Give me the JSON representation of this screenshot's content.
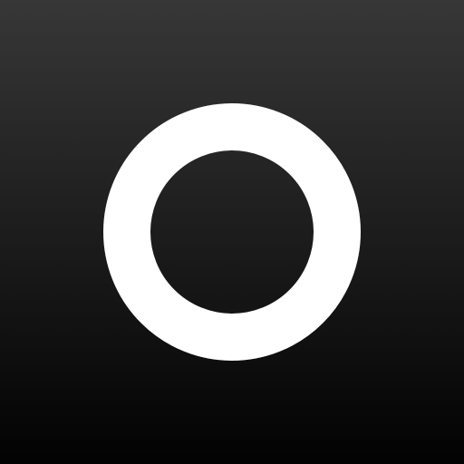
{
  "icon": {
    "name": "ring-logo-icon",
    "glyph": "ring",
    "background_gradient": {
      "top_color": "#373737",
      "bottom_color": "#020202"
    },
    "ring_color": "#FFFFFF"
  }
}
